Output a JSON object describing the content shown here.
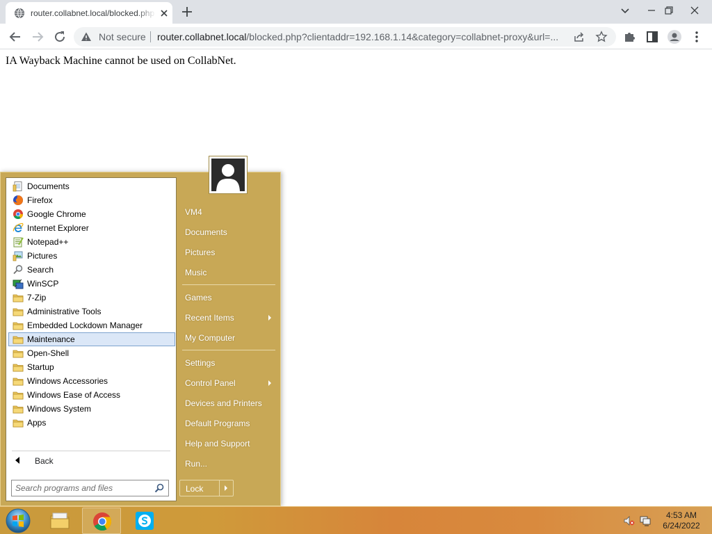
{
  "browser": {
    "tab_title": "router.collabnet.local/blocked.php",
    "security_label": "Not secure",
    "url_host": "router.collabnet.local",
    "url_rest": "/blocked.php?clientaddr=192.168.1.14&category=collabnet-proxy&url=..."
  },
  "page": {
    "message": "IA Wayback Machine cannot be used on CollabNet."
  },
  "start_menu": {
    "programs": [
      {
        "label": "Documents",
        "icon": "documents-library-icon"
      },
      {
        "label": "Firefox",
        "icon": "firefox-icon"
      },
      {
        "label": "Google Chrome",
        "icon": "chrome-icon"
      },
      {
        "label": "Internet Explorer",
        "icon": "internet-explorer-icon"
      },
      {
        "label": "Notepad++",
        "icon": "notepad-plus-plus-icon"
      },
      {
        "label": "Pictures",
        "icon": "pictures-library-icon"
      },
      {
        "label": "Search",
        "icon": "search-icon"
      },
      {
        "label": "WinSCP",
        "icon": "winscp-icon"
      },
      {
        "label": "7-Zip",
        "icon": "folder-icon"
      },
      {
        "label": "Administrative Tools",
        "icon": "folder-icon"
      },
      {
        "label": "Embedded Lockdown Manager",
        "icon": "folder-icon"
      },
      {
        "label": "Maintenance",
        "icon": "folder-icon",
        "selected": true
      },
      {
        "label": "Open-Shell",
        "icon": "folder-icon"
      },
      {
        "label": "Startup",
        "icon": "folder-icon"
      },
      {
        "label": "Windows Accessories",
        "icon": "folder-icon"
      },
      {
        "label": "Windows Ease of Access",
        "icon": "folder-icon"
      },
      {
        "label": "Windows System",
        "icon": "folder-icon"
      },
      {
        "label": "Apps",
        "icon": "folder-icon"
      }
    ],
    "back_label": "Back",
    "search_placeholder": "Search programs and files",
    "places": {
      "user": "VM4",
      "documents": "Documents",
      "pictures": "Pictures",
      "music": "Music",
      "games": "Games",
      "recent_items": "Recent Items",
      "my_computer": "My Computer",
      "settings": "Settings",
      "control_panel": "Control Panel",
      "devices_printers": "Devices and Printers",
      "default_programs": "Default Programs",
      "help_support": "Help and Support",
      "run": "Run..."
    },
    "lock_label": "Lock"
  },
  "taskbar": {
    "pinned": [
      "file-explorer-icon",
      "chrome-icon",
      "skype-icon"
    ],
    "time": "4:53 AM",
    "date": "6/24/2022"
  },
  "colors": {
    "menu_accent": "#c8a856",
    "selection": "#dbe7f7"
  }
}
